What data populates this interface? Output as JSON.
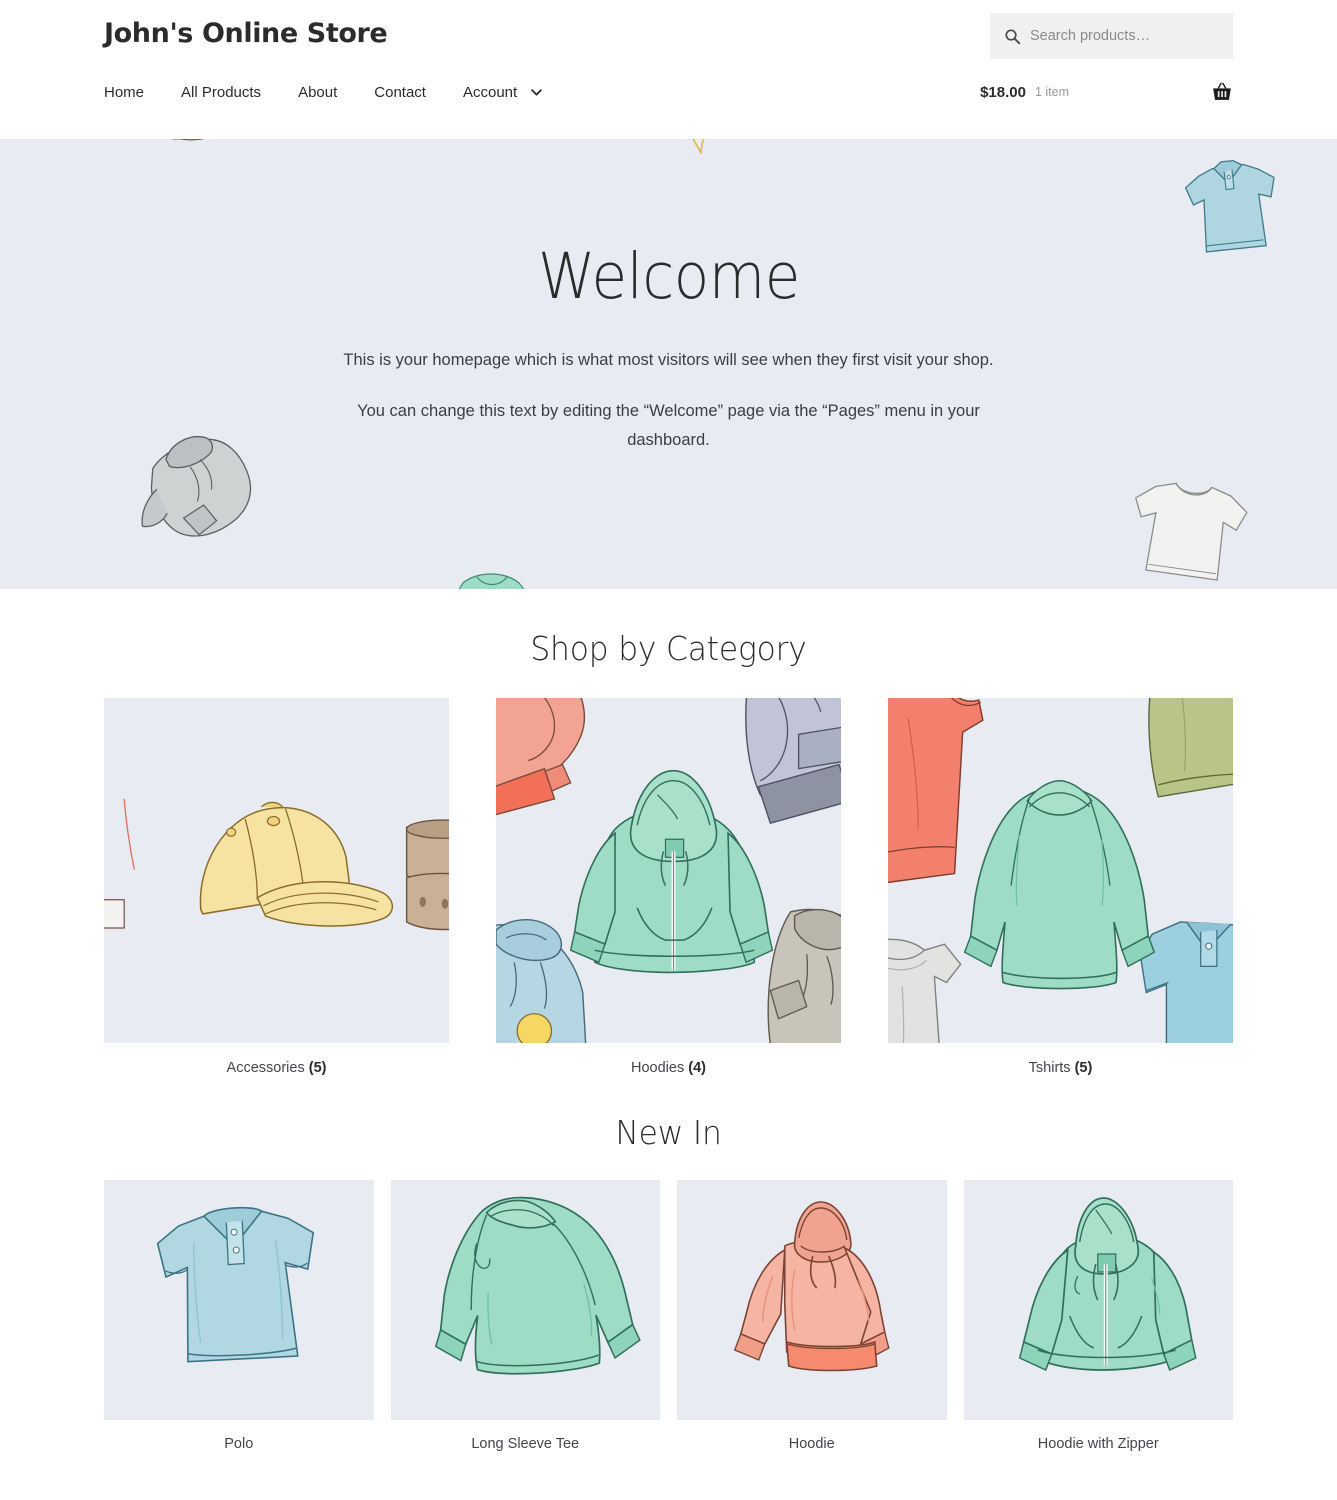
{
  "header": {
    "site_title": "John's Online Store",
    "search": {
      "placeholder": "Search products…",
      "value": "",
      "icon": "search-icon"
    },
    "nav": [
      {
        "label": "Home",
        "has_caret": false
      },
      {
        "label": "All Products",
        "has_caret": false
      },
      {
        "label": "About",
        "has_caret": false
      },
      {
        "label": "Contact",
        "has_caret": false
      },
      {
        "label": "Account",
        "has_caret": true
      }
    ],
    "cart": {
      "total": "$18.00",
      "count": "1 item",
      "icon": "shopping-basket-icon"
    }
  },
  "hero": {
    "title": "Welcome",
    "paragraph_1": "This is your homepage which is what most visitors will see when they first visit your shop.",
    "paragraph_2": "You can change this text by editing the “Welcome” page via the “Pages” menu in your dashboard.",
    "background_color": "#e8ecf2"
  },
  "categories_section": {
    "title": "Shop by Category",
    "items": [
      {
        "name": "Accessories",
        "count": "(5)",
        "image": "beanie-cap-belt-illustration"
      },
      {
        "name": "Hoodies",
        "count": "(4)",
        "image": "zip-hoodie-collage-illustration"
      },
      {
        "name": "Tshirts",
        "count": "(5)",
        "image": "long-sleeve-tee-collage-illustration"
      }
    ]
  },
  "new_in_section": {
    "title": "New In",
    "items": [
      {
        "name": "Polo",
        "image": "light-blue-polo-illustration"
      },
      {
        "name": "Long Sleeve Tee",
        "image": "mint-long-sleeve-tee-illustration"
      },
      {
        "name": "Hoodie",
        "image": "coral-pullover-hoodie-illustration"
      },
      {
        "name": "Hoodie with Zipper",
        "image": "mint-zip-hoodie-illustration"
      }
    ]
  },
  "colors": {
    "hero_bg": "#e8ecf2",
    "page_bg": "#ffffff",
    "text": "#43454b",
    "heading": "#2b2b2b",
    "muted": "#9a9a9a",
    "search_bg": "#f0f0f0",
    "coral": "#f3a08e",
    "mint": "#9bdcc4",
    "lightblue": "#aed3de",
    "gray": "#c9cdd0",
    "yellow": "#f7e3a1",
    "tan": "#c9b096",
    "olive": "#bcc68d",
    "lavender": "#bfc3d6"
  }
}
